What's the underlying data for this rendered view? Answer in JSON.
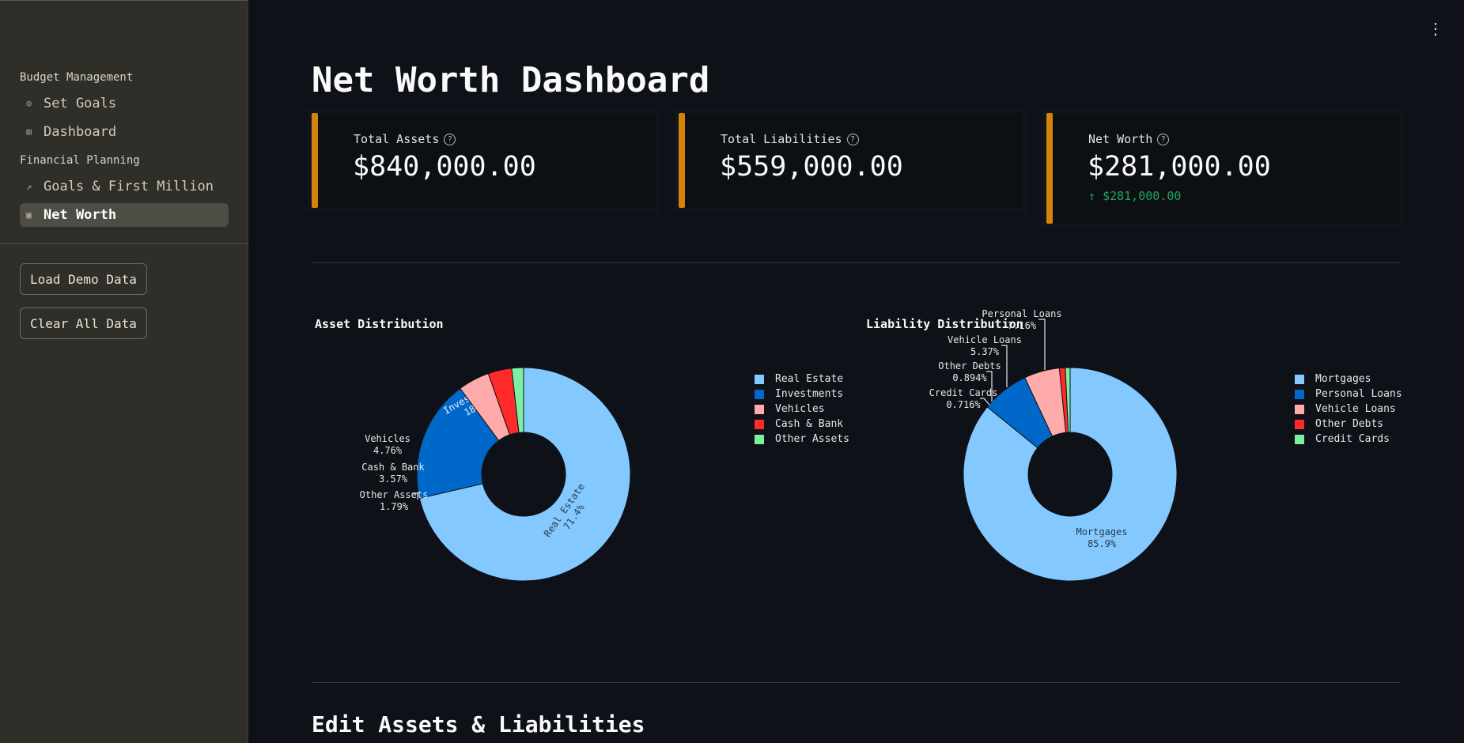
{
  "sidebar": {
    "groups": [
      {
        "title": "Budget Management"
      },
      {
        "title": "Financial Planning"
      }
    ],
    "items": [
      {
        "label": "Set Goals",
        "icon": "target-icon"
      },
      {
        "label": "Dashboard",
        "icon": "grid-icon"
      },
      {
        "label": "Goals & First Million",
        "icon": "trend-icon"
      },
      {
        "label": "Net Worth",
        "icon": "wallet-icon",
        "active": true
      }
    ],
    "buttons": {
      "load_demo": "Load Demo Data",
      "clear_all": "Clear All Data"
    }
  },
  "page_title": "Net Worth Dashboard",
  "metrics": [
    {
      "label": "Total Assets",
      "value": "$840,000.00"
    },
    {
      "label": "Total Liabilities",
      "value": "$559,000.00"
    },
    {
      "label": "Net Worth",
      "value": "$281,000.00",
      "delta": "$281,000.00"
    }
  ],
  "colors": {
    "accent": "#d4840a",
    "positive": "#21a65b"
  },
  "section_title": "Edit Assets & Liabilities",
  "chart_data": [
    {
      "type": "pie",
      "title": "Asset Distribution",
      "categories": [
        "Real Estate",
        "Investments",
        "Vehicles",
        "Cash & Bank",
        "Other Assets"
      ],
      "values": [
        71.4,
        18.5,
        4.76,
        3.57,
        1.79
      ],
      "labels": [
        "71.4%",
        "18.5%",
        "4.76%",
        "3.57%",
        "1.79%"
      ],
      "colors": [
        "#83c9ff",
        "#0068c9",
        "#ffabab",
        "#ff2b2b",
        "#7defa1"
      ],
      "hole": true,
      "legend": "right"
    },
    {
      "type": "pie",
      "title": "Liability Distribution",
      "categories": [
        "Mortgages",
        "Personal Loans",
        "Vehicle Loans",
        "Other Debts",
        "Credit Cards"
      ],
      "values": [
        85.9,
        7.16,
        5.37,
        0.894,
        0.716
      ],
      "labels": [
        "85.9%",
        "7.16%",
        "5.37%",
        "0.894%",
        "0.716%"
      ],
      "colors": [
        "#83c9ff",
        "#0068c9",
        "#ffabab",
        "#ff2b2b",
        "#7defa1"
      ],
      "hole": true,
      "legend": "right"
    }
  ]
}
